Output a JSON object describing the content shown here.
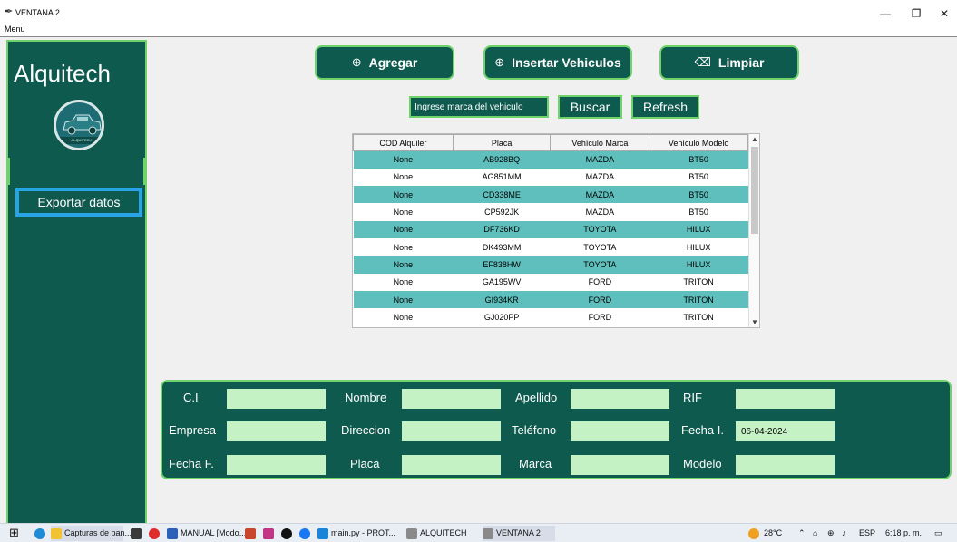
{
  "window": {
    "title": "VENTANA 2",
    "menu_label": "Menu",
    "minimize": "—",
    "maximize": "❐",
    "close": "✕"
  },
  "sidebar": {
    "brand": "Alquitech",
    "logo_text": "ALQUITECH",
    "export_button": "Exportar datos"
  },
  "toolbar": {
    "add": "Agregar",
    "insert": "Insertar Vehiculos",
    "clear": "Limpiar"
  },
  "search": {
    "placeholder": "Ingrese marca del vehiculo",
    "search_button": "Buscar",
    "refresh_button": "Refresh"
  },
  "table": {
    "columns": [
      "COD Alquiler",
      "Placa",
      "Vehículo Marca",
      "Vehículo Modelo"
    ],
    "rows": [
      [
        "None",
        "AB928BQ",
        "MAZDA",
        "BT50"
      ],
      [
        "None",
        "AG851MM",
        "MAZDA",
        "BT50"
      ],
      [
        "None",
        "CD338ME",
        "MAZDA",
        "BT50"
      ],
      [
        "None",
        "CP592JK",
        "MAZDA",
        "BT50"
      ],
      [
        "None",
        "DF736KD",
        "TOYOTA",
        "HILUX"
      ],
      [
        "None",
        "DK493MM",
        "TOYOTA",
        "HILUX"
      ],
      [
        "None",
        "EF838HW",
        "TOYOTA",
        "HILUX"
      ],
      [
        "None",
        "GA195WV",
        "FORD",
        "TRITON"
      ],
      [
        "None",
        "GI934KR",
        "FORD",
        "TRITON"
      ],
      [
        "None",
        "GJ020PP",
        "FORD",
        "TRITON"
      ]
    ]
  },
  "form": {
    "ci_label": "C.I",
    "nombre_label": "Nombre",
    "apellido_label": "Apellido",
    "rif_label": "RIF",
    "empresa_label": "Empresa",
    "direccion_label": "Direccion",
    "telefono_label": "Teléfono",
    "fecha_i_label": "Fecha I.",
    "fecha_i_value": "06-04-2024",
    "fecha_f_label": "Fecha F.",
    "placa_label": "Placa",
    "marca_label": "Marca",
    "modelo_label": "Modelo"
  },
  "taskbar": {
    "items": [
      "Capturas de pan...",
      "MANUAL [Modo...",
      "main.py - PROT...",
      "ALQUITECH",
      "VENTANA 2"
    ],
    "temperature": "28°C",
    "language": "ESP",
    "time": "6:18 p. m."
  },
  "colors": {
    "panel": "#0e5a4e",
    "border": "#6fd36a",
    "field": "#c5f2c5",
    "row_highlight": "#5fbfbd",
    "export_border": "#27a3e6"
  }
}
